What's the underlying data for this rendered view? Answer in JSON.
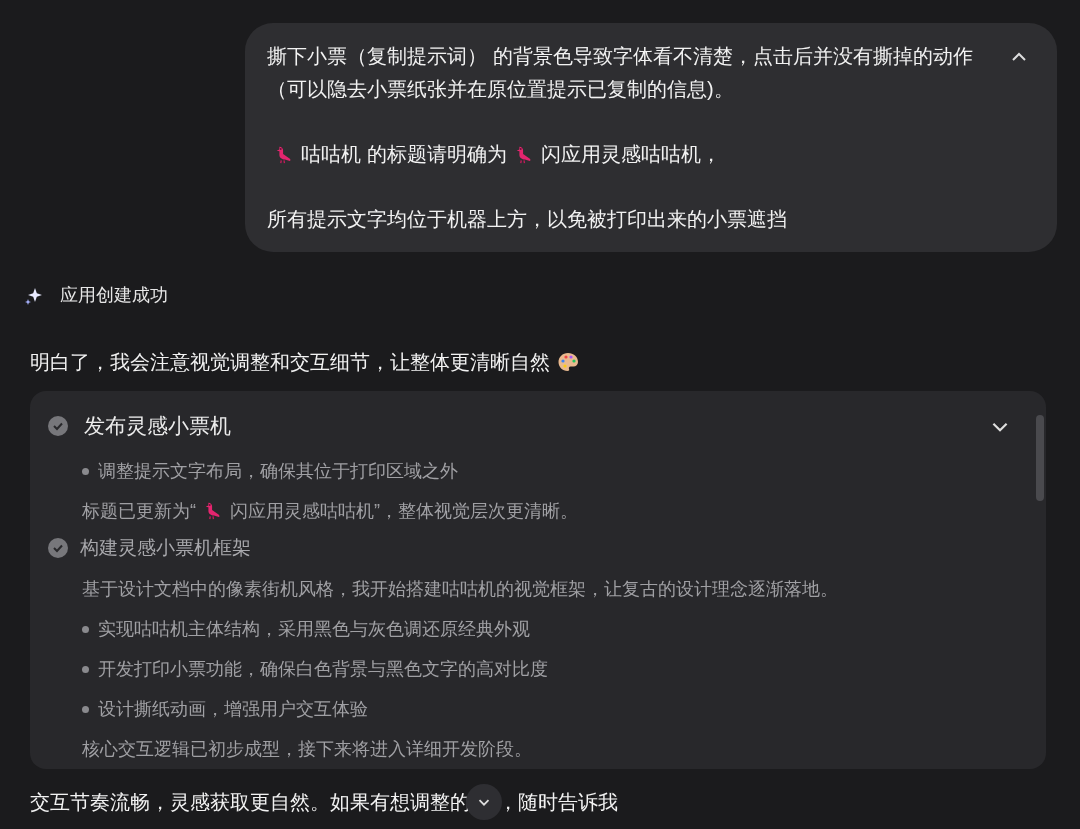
{
  "user_message": {
    "expanded": true,
    "paragraphs": [
      [
        {
          "kind": "text",
          "text": "撕下小票（复制提示词） 的背景色导致字体看不清楚，点击后并没有撕掉的动作（可以隐去小票纸张并在原位置提示已复制的信息)。"
        }
      ],
      [
        {
          "kind": "bird"
        },
        {
          "kind": "text",
          "text": "咕咕机 的标题请明确为"
        },
        {
          "kind": "bird"
        },
        {
          "kind": "text",
          "text": "闪应用灵感咕咕机，"
        }
      ],
      [
        {
          "kind": "text",
          "text": "所有提示文字均位于机器上方，以免被打印出来的小票遮挡"
        }
      ]
    ]
  },
  "status": {
    "label": "应用创建成功"
  },
  "reply_intro": "明白了，我会注意视觉调整和交互细节，让整体更清晰自然",
  "steps_panel": {
    "expanded": true,
    "steps": [
      {
        "title": "发布灵感小票机",
        "done": true,
        "active": true,
        "lines": [
          {
            "kind": "bullet",
            "parts": [
              {
                "kind": "text",
                "text": "调整提示文字布局，确保其位于打印区域之外"
              }
            ]
          },
          {
            "kind": "note",
            "parts": [
              {
                "kind": "text",
                "text": "标题已更新为“"
              },
              {
                "kind": "bird"
              },
              {
                "kind": "text",
                "text": "闪应用灵感咕咕机”，整体视觉层次更清晰。"
              }
            ]
          }
        ]
      },
      {
        "title": "构建灵感小票机框架",
        "done": true,
        "active": false,
        "lines": [
          {
            "kind": "note",
            "parts": [
              {
                "kind": "text",
                "text": "基于设计文档中的像素街机风格，我开始搭建咕咕机的视觉框架，让复古的设计理念逐渐落地。"
              }
            ]
          },
          {
            "kind": "bullet",
            "parts": [
              {
                "kind": "text",
                "text": "实现咕咕机主体结构，采用黑色与灰色调还原经典外观"
              }
            ]
          },
          {
            "kind": "bullet",
            "parts": [
              {
                "kind": "text",
                "text": "开发打印小票功能，确保白色背景与黑色文字的高对比度"
              }
            ]
          },
          {
            "kind": "bullet",
            "parts": [
              {
                "kind": "text",
                "text": "设计撕纸动画，增强用户交互体验"
              }
            ]
          },
          {
            "kind": "note",
            "parts": [
              {
                "kind": "text",
                "text": "核心交互逻辑已初步成型，接下来将进入详细开发阶段。"
              }
            ]
          }
        ]
      }
    ]
  },
  "closing": {
    "before": "交互节奏流畅，灵感获取更自然。如果有想调整的",
    "after": "，随时告诉我"
  }
}
